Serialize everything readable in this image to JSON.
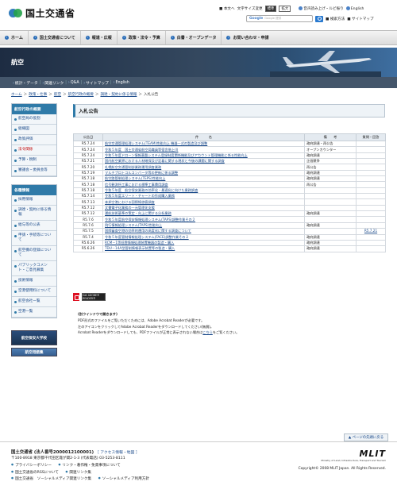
{
  "header": {
    "site_title": "国土交通省",
    "text_size_label": "文字サイズ変更",
    "home_label": "本文へ",
    "size_normal": "標準",
    "size_large": "拡大",
    "voice_label": "音声読み上げ・ルビ振り",
    "english_label": "English",
    "search_placeholder": "Google 提供",
    "search_brand": "Google",
    "search_method_label": "検索方法",
    "sitemap_label": "サイトマップ"
  },
  "gnav": [
    {
      "label": "ホーム"
    },
    {
      "label": "国土交通省について"
    },
    {
      "label": "報道・広報"
    },
    {
      "label": "政策・法令・予算"
    },
    {
      "label": "白書・オープンデータ"
    },
    {
      "label": "お問い合わせ・申請"
    }
  ],
  "banner": {
    "title": "航空"
  },
  "subnav": [
    "統計・データ",
    "関連リンク",
    "Q&A",
    "サイトマップ",
    "English"
  ],
  "breadcrumb": [
    "ホーム",
    "政策・仕事",
    "航空",
    "航空行政の概要",
    "調達・契約に係る情報",
    "入札公告"
  ],
  "sidebar": {
    "box1_title": "航空行政の概要",
    "box1_items": [
      "航空局の役割",
      "組織図",
      "政策評価",
      "法令関係",
      "予算・税制",
      "審議会・委員会等"
    ],
    "box2_title": "各種情報",
    "box2_items": [
      "採用情報",
      "調達・契約に係る情報",
      "給与等の公表",
      "申請・手続等について",
      "航空機の登録について",
      "パブリックコメント・ご意見募集",
      "技術情報",
      "空港使用料について",
      "航空会社一覧",
      "空港一覧"
    ],
    "banner1": "航空保安大学校",
    "banner2": "航空用語集"
  },
  "main": {
    "title": "入札公告",
    "columns": [
      "公告日",
      "件　　　名",
      "備　　考",
      "質問・回答"
    ],
    "rows": [
      {
        "date": "R5.7.24",
        "name": "航空交通管理処理システム(TEAM)性能向上 機器一式の製造及び調整",
        "note": "政府調達・再公告",
        "qa": ""
      },
      {
        "date": "R5.7.24",
        "name": "令和５年度　国土交通省航空局職員等宿舎借上(Ⅰ)",
        "note": "オープンカウンター",
        "qa": ""
      },
      {
        "date": "R5.7.24",
        "name": "令和５年度ドローン情報基盤システム登録制度関係機能及びアカウント管理機能に係る性能向上",
        "note": "政府調達",
        "qa": ""
      },
      {
        "date": "R5.7.21",
        "name": "国内航空業界における人材確保及び定着に関する現状と今後の課題に関する調査",
        "note": "企画競争",
        "qa": ""
      },
      {
        "date": "R5.7.20",
        "name": "札幌航空交通管制部業務運用調査業務",
        "note": "再公告",
        "qa": ""
      },
      {
        "date": "R5.7.19",
        "name": "マルチプロトコルコンバータ等の更新に係る調整",
        "note": "政府調達",
        "qa": ""
      },
      {
        "date": "R5.7.18",
        "name": "航空路管制処理システム(TEPS)性能向上",
        "note": "政府調達",
        "qa": ""
      },
      {
        "date": "R5.7.18",
        "name": "信号観測所工事における標準工事費用調査",
        "note": "再公告",
        "qa": ""
      },
      {
        "date": "R5.7.18",
        "name": "令和５年度　航空保安業務の効率化・最適化に向けた業務調査",
        "note": "",
        "qa": ""
      },
      {
        "date": "R5.7.14",
        "name": "令和５年度エリート・チャートの作成購入業務",
        "note": "",
        "qa": ""
      },
      {
        "date": "R5.7.13",
        "name": "本邦空港における国際線旅客調査",
        "note": "",
        "qa": ""
      },
      {
        "date": "R5.7.12",
        "name": "文書電子化業務の一元管理化支援",
        "note": "",
        "qa": ""
      },
      {
        "date": "R5.7.12",
        "name": "運航技術基準の策定・向上に関する分析業務",
        "note": "政府調達",
        "qa": ""
      },
      {
        "date": "R5.7.6",
        "name": "令和５年度航空保安情報処理システム(TAPS)調整作業その２",
        "note": "",
        "qa": ""
      },
      {
        "date": "R5.7.6",
        "name": "飛行情報処理システム(TAPS)性能向上",
        "note": "政府調達",
        "qa": ""
      },
      {
        "date": "R5.7.5",
        "name": "国際審査空港の効率的運用の高度化に関する調査について",
        "note": "",
        "qa": "R5.7.21"
      },
      {
        "date": "R5.7.4",
        "name": "令和５年度管制情報処理システム(FACE)調整作業その２",
        "note": "政府調達",
        "qa": ""
      },
      {
        "date": "R5.6.26",
        "name": "RCM－1等低雲情報処理装置機器の製造・購入",
        "note": "政府調達",
        "qa": ""
      },
      {
        "date": "R5.6.26",
        "name": "TDU－14A型管制情報表示装置等の製造・購入",
        "note": "政府調達",
        "qa": ""
      }
    ],
    "adobe_badge": "Get ADOBE® READER®",
    "note_title": "(別ウインドウで開きます)",
    "note_lines": [
      "PDF形式のファイルをご覧いただくためには、Adobe Acrobat Readerが必要です。",
      "左のアイコンをクリックしてAdobe Acrobat Readerをダウンロードしてください(無償)。",
      "Acrobat Readerをダウンロードしても、PDFファイルが正常に表示されない場合は"
    ],
    "note_link": "こちら",
    "note_tail": "をご覧ください。"
  },
  "pagetop_label": "ページの先頭に戻る",
  "footer": {
    "org": "国土交通省 (法人番号2000012100001)",
    "access": "［ アクセス情報・地図 ］",
    "address": "〒100-8918 東京都千代田区霞が関2-1-3 (代表電話) 03-5253-8111",
    "links": [
      "プライバシーポリシー",
      "リンク・著作権・免責事項について",
      "国土交通省のRSSについて",
      "関連リンク集",
      "国土交通省　ソーシャルメディア関連リンク集",
      "ソーシャルメディア利用方針"
    ],
    "mlit": "MLIT",
    "mlit_sub": "Ministry of Land, Infrastructure, Transport and Tourism",
    "copyright": "Copyright© 2008 MLIT Japan. All Rights Reserved."
  }
}
